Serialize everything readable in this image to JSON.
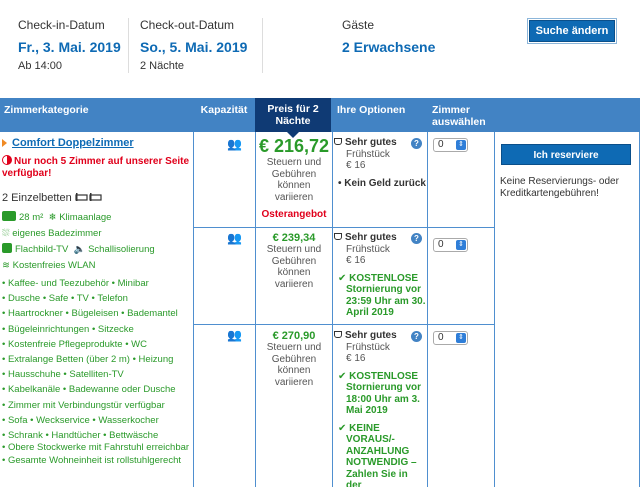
{
  "search": {
    "checkin_label": "Check-in-Datum",
    "checkin_value": "Fr., 3. Mai. 2019",
    "checkin_sub": "Ab 14:00",
    "checkout_label": "Check-out-Datum",
    "checkout_value": "So., 5. Mai. 2019",
    "checkout_sub": "2 Nächte",
    "guests_label": "Gäste",
    "guests_value": "2 Erwachsene",
    "change_button": "Suche ändern"
  },
  "table_header": {
    "room_category": "Zimmerkategorie",
    "capacity": "Kapazität",
    "price": "Preis für 2 Nächte",
    "options": "Ihre Optionen",
    "rooms_select": "Zimmer auswählen"
  },
  "room": {
    "name": "Comfort Doppelzimmer",
    "scarcity": "Nur noch 5 Zimmer auf unserer Seite verfügbar!",
    "beds": "2 Einzelbetten",
    "size": "28 m²",
    "features": [
      "Klimaanlage",
      "eigenes Badezimmer",
      "Flachbild-TV",
      "Schallisolierung",
      "Kostenfreies WLAN"
    ],
    "amenities": [
      "• Kaffee- und Teezubehör  • Minibar",
      "• Dusche  • Safe  • TV  • Telefon",
      "• Haartrockner  • Bügeleisen  • Bademantel",
      "• Bügeleinrichtungen  • Sitzecke",
      "• Kostenfreie Pflegeprodukte  • WC",
      "• Extralange Betten (über 2 m)  • Heizung",
      "• Hausschuhe  • Satelliten-TV",
      "• Kabelkanäle  • Badewanne oder Dusche",
      "• Zimmer mit Verbindungstür verfügbar",
      "• Sofa  • Weckservice  • Wasserkocher",
      "• Schrank  • Handtücher  • Bettwäsche",
      "• Obere Stockwerke mit Fahrstuhl erreichbar",
      "• Gesamte Wohneinheit ist rollstuhlgerecht"
    ]
  },
  "offers": [
    {
      "price": "€ 216,72",
      "note": "Steuern und Gebühren können variieren",
      "tag": "Osterangebot",
      "breakfast_title": "Sehr gutes",
      "breakfast_sub": "Frühstück",
      "breakfast_price": "€ 16",
      "condition": "Kein Geld zurück",
      "select_value": "0"
    },
    {
      "price": "€ 239,34",
      "note": "Steuern und Gebühren können variieren",
      "breakfast_title": "Sehr gutes",
      "breakfast_sub": "Frühstück",
      "breakfast_price": "€ 16",
      "condition": "KOSTENLOSE Stornierung vor 23:59 Uhr am 30. April 2019",
      "select_value": "0"
    },
    {
      "price": "€ 270,90",
      "note": "Steuern und Gebühren können variieren",
      "breakfast_title": "Sehr gutes",
      "breakfast_sub": "Frühstück",
      "breakfast_price": "€ 16",
      "condition": "KOSTENLOSE Stornierung vor 18:00 Uhr am 3. Mai 2019",
      "condition2": "KEINE VORAUS/-ANZAHLUNG NOTWENDIG – Zahlen Sie in der",
      "select_value": "0"
    }
  ],
  "reserve": {
    "button": "Ich reserviere",
    "note": "Keine Reservierungs- oder Kreditkartengebühren!"
  },
  "colors": {
    "brand_blue": "#0e6ab4",
    "header_blue": "#4283c4",
    "price_header": "#0f3a74",
    "green": "#2a9a2a",
    "red": "#e0001b"
  }
}
